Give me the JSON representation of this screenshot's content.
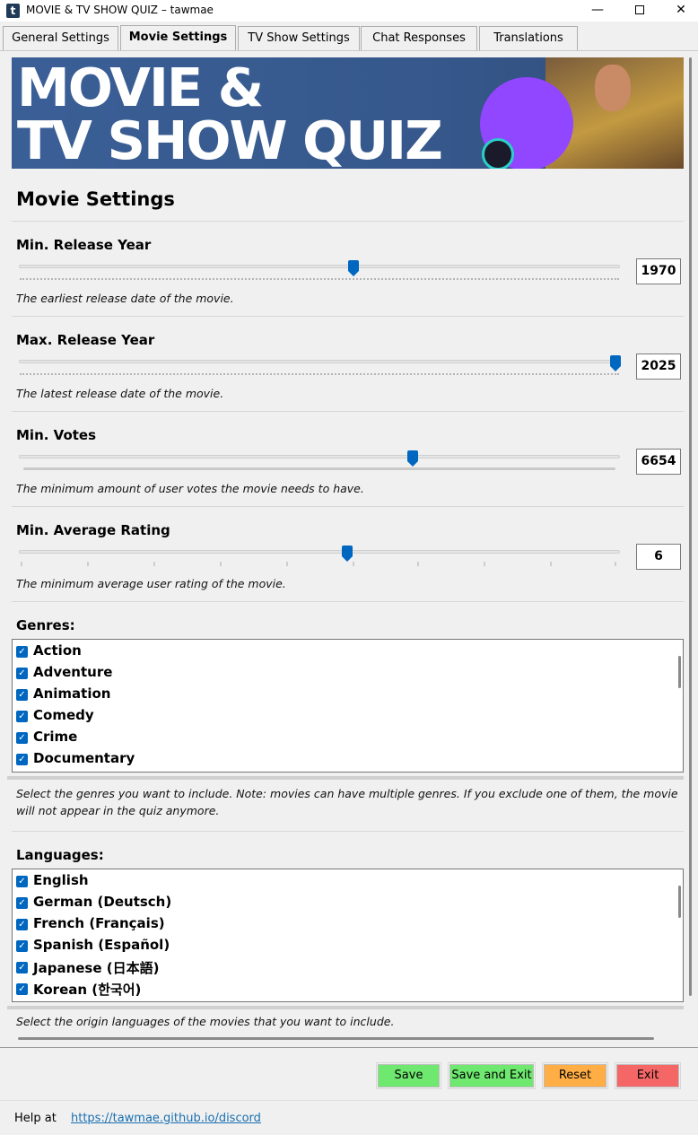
{
  "window": {
    "title": "MOVIE & TV SHOW QUIZ – tawmae",
    "minimize": "—",
    "close": "✕"
  },
  "tabs": [
    {
      "label": "General Settings"
    },
    {
      "label": "Movie Settings"
    },
    {
      "label": "TV Show Settings"
    },
    {
      "label": "Chat Responses"
    },
    {
      "label": "Translations"
    }
  ],
  "banner": {
    "line1": "MOVIE &",
    "line2": "TV SHOW QUIZ"
  },
  "page_title": "Movie Settings",
  "settings": {
    "min_release_year": {
      "label": "Min. Release Year",
      "value": "1970",
      "description": "The earliest release date of the movie.",
      "level": 0.56
    },
    "max_release_year": {
      "label": "Max. Release Year",
      "value": "2025",
      "description": "The latest release date of the movie.",
      "level": 1.0
    },
    "min_votes": {
      "label": "Min. Votes",
      "value": "6654",
      "description": "The minimum amount of user votes the movie needs to have.",
      "level": 0.66
    },
    "min_avg_rating": {
      "label": "Min. Average Rating",
      "value": "6",
      "description": "The minimum average user rating of the movie.",
      "level": 0.55
    }
  },
  "genres": {
    "label": "Genres:",
    "items": [
      "Action",
      "Adventure",
      "Animation",
      "Comedy",
      "Crime",
      "Documentary"
    ],
    "description": "Select the genres you want to include. Note: movies can have multiple genres. If you exclude one of them, the movie will not appear in the quiz anymore."
  },
  "languages": {
    "label": "Languages:",
    "items": [
      "English",
      "German (Deutsch)",
      "French (Français)",
      "Spanish (Español)",
      "Japanese (日本語)",
      "Korean (한국어)"
    ],
    "description": "Select the origin languages of the movies that you want to include."
  },
  "buttons": {
    "save": "Save",
    "save_exit": "Save and Exit",
    "reset": "Reset",
    "exit": "Exit"
  },
  "help": {
    "label": "Help at",
    "link": "https://tawmae.github.io/discord"
  },
  "colors": {
    "accent": "#0067c0",
    "save": "#6ee86e",
    "reset": "#ffad45",
    "exit": "#f56767"
  }
}
